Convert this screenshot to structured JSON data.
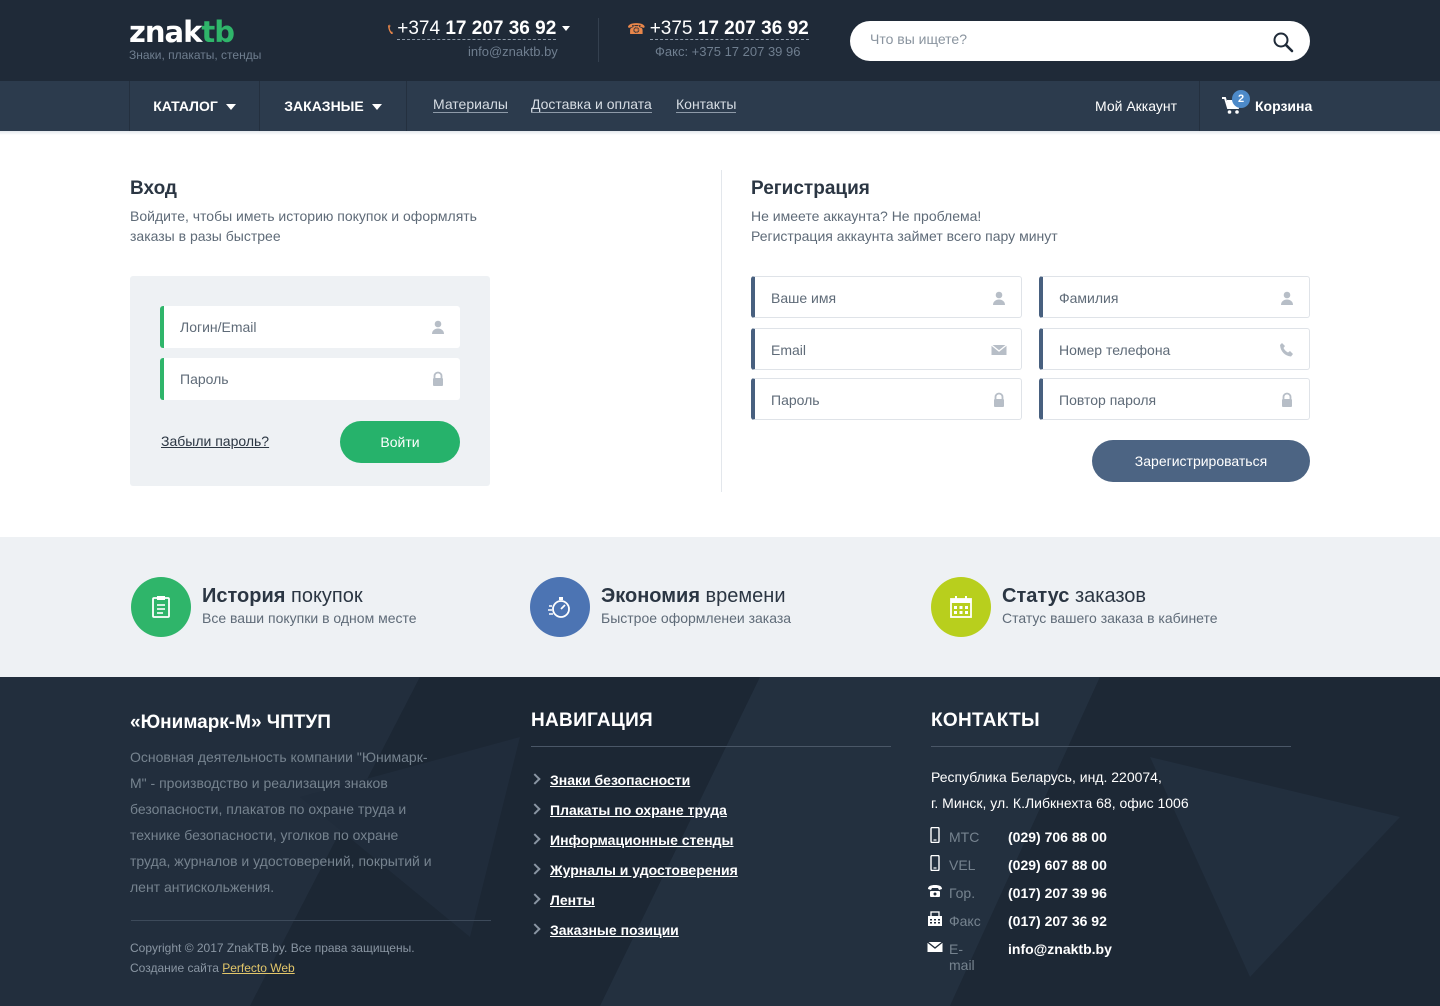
{
  "header": {
    "logo_word_main": "znak",
    "logo_word_accent": "tb",
    "tagline": "Знаки, плакаты, стенды",
    "phone1_prefix": "+374 ",
    "phone1_number": "17 207 36 92",
    "email": "info@znaktb.by",
    "phone2_prefix": "+375 ",
    "phone2_number": "17 207 36 92",
    "fax": "Факс: +375 17 207 39 96",
    "search_placeholder": "Что вы ищете?"
  },
  "nav": {
    "catalog": "КАТАЛОГ",
    "custom": "ЗАКАЗНЫЕ",
    "links": [
      "Материалы",
      "Доставка и оплата",
      "Контакты"
    ],
    "account": "Мой Аккаунт",
    "cart_label": "Корзина",
    "cart_count": "2"
  },
  "login": {
    "title": "Вход",
    "description": "Войдите, чтобы иметь историю покупок и оформлять заказы в разы быстрее",
    "login_placeholder": "Логин/Email",
    "password_placeholder": "Пароль",
    "forgot": "Забыли пароль?",
    "submit": "Войти"
  },
  "register": {
    "title": "Регистрация",
    "description_line1": "Не имеете аккаунта? Не проблема!",
    "description_line2": "Регистрация аккаунта займет всего пару минут",
    "fields": {
      "name": "Ваше имя",
      "surname": "Фамилия",
      "email": "Email",
      "phone": "Номер телефона",
      "password": "Пароль",
      "password_repeat": "Повтор пароля"
    },
    "submit": "Зарегистрироваться"
  },
  "features": [
    {
      "bold": "История",
      "rest": " покупок",
      "subtitle": "Все ваши покупки в одном месте",
      "color": "#2fb56a",
      "icon": "clipboard-icon"
    },
    {
      "bold": "Экономия",
      "rest": " времени",
      "subtitle": "Быстрое оформленеи заказа",
      "color": "#4c74b3",
      "icon": "stopwatch-icon"
    },
    {
      "bold": "Статус",
      "rest": " заказов",
      "subtitle": "Статус вашего заказа в кабинете",
      "color": "#b8cf1d",
      "icon": "calendar-icon"
    }
  ],
  "footer": {
    "company": "«Юнимарк-М» ЧПТУП",
    "about": "Основная деятельность компании \"Юнимарк-М\" - производство и реализация знаков безопасности, плакатов по охране труда и технике безопасности, уголков по охране труда, журналов и удостоверений, покрытий и лент антискольжения.",
    "copyright": "Copyright © 2017 ZnakTB.by. Все права защищены.",
    "credit_prefix": "Создание сайта ",
    "credit_link": "Perfecto Web",
    "nav_title": "НАВИГАЦИЯ",
    "nav_items": [
      "Знаки безопасности",
      "Плакаты по охране труда",
      "Информационные стенды",
      "Журналы и удостоверения",
      "Ленты",
      "Заказные позиции"
    ],
    "contacts_title": "КОНТАКТЫ",
    "address_line1": "Республика Беларусь, инд. 220074,",
    "address_line2": "г. Минск, ул. К.Либкнехта 68, офис 1006",
    "contacts": [
      {
        "label": "МТС",
        "value": "(029) 706 88 00",
        "icon": "mobile-icon"
      },
      {
        "label": "VEL",
        "value": "(029) 607 88 00",
        "icon": "mobile-icon"
      },
      {
        "label": "Гор.",
        "value": "(017) 207 39 96",
        "icon": "phone-icon"
      },
      {
        "label": "Факс",
        "value": "(017) 207 36 92",
        "icon": "fax-icon"
      },
      {
        "label": "E-mail",
        "value": "info@znaktb.by",
        "icon": "envelope-icon"
      }
    ]
  }
}
